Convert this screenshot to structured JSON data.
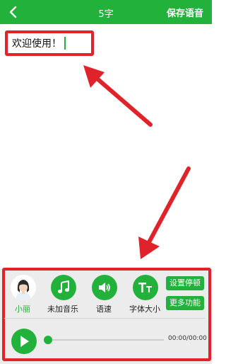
{
  "header": {
    "back_icon": "chevron-left-icon",
    "title": "5字",
    "save_label": "保存语音",
    "background": "#22b13b"
  },
  "editor": {
    "text": "欢迎使用！"
  },
  "toolbar": {
    "items": [
      {
        "label": "小丽",
        "icon": "avatar-icon",
        "active": true
      },
      {
        "label": "未加音乐",
        "icon": "music-note-icon",
        "active": false
      },
      {
        "label": "语速",
        "icon": "speaker-icon",
        "active": false
      },
      {
        "label": "字体大小",
        "icon": "font-size-icon",
        "active": false
      }
    ],
    "side_buttons": [
      "设置停顿",
      "更多功能"
    ]
  },
  "player": {
    "play_icon": "play-icon",
    "time": "00:00/00:00",
    "progress": 0
  },
  "colors": {
    "accent": "#22b13b",
    "highlight": "#e0222b"
  }
}
